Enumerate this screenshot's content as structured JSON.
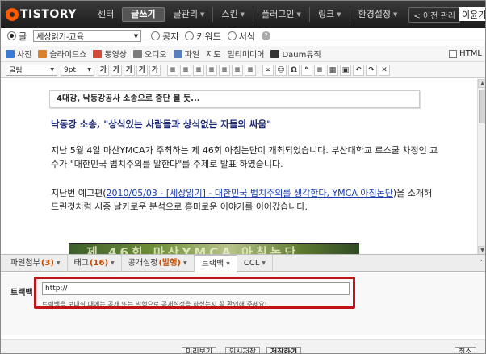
{
  "topbar": {
    "logo": "TISTORY",
    "nav": [
      {
        "label": "센터",
        "active": false,
        "caret": false
      },
      {
        "label": "글쓰기",
        "active": true,
        "caret": false
      },
      {
        "label": "글관리",
        "active": false,
        "caret": true
      },
      {
        "label": "스킨",
        "active": false,
        "caret": true
      },
      {
        "label": "플러그인",
        "active": false,
        "caret": true
      },
      {
        "label": "링크",
        "active": false,
        "caret": true
      },
      {
        "label": "환경설정",
        "active": false,
        "caret": true
      }
    ],
    "old_admin": "< 이전 관리",
    "user": "이윤기"
  },
  "category_row": {
    "type_label": "글",
    "category_value": "세상읽기-교육",
    "options": [
      "공지",
      "키워드",
      "서식"
    ]
  },
  "toolbar1": {
    "items": [
      {
        "label": "사진",
        "icon": "photo-icon",
        "color": "#3a7bd5"
      },
      {
        "label": "슬라이드쇼",
        "icon": "slideshow-icon",
        "color": "#d9822b"
      },
      {
        "label": "동영상",
        "icon": "video-icon",
        "color": "#d24a3c"
      },
      {
        "label": "오디오",
        "icon": "audio-icon",
        "color": "#7b7b7b"
      },
      {
        "label": "파일",
        "icon": "file-icon",
        "color": "#5a7fbf"
      },
      {
        "label": "지도",
        "icon": "",
        "color": ""
      },
      {
        "label": "멀티미디어",
        "icon": "",
        "color": ""
      },
      {
        "label": "Daum뮤직",
        "icon": "music-icon",
        "color": "#333333"
      }
    ],
    "html_label": "HTML"
  },
  "toolbar2": {
    "font": "굴림",
    "size": "9pt",
    "buttons": [
      "가",
      "가",
      "가",
      "가",
      "가",
      "≡",
      "≡",
      "≡",
      "≡",
      "≡",
      "≡",
      "≡",
      "∞",
      "☺",
      "Ω",
      "“",
      "≡",
      "▦",
      "▣",
      "↶",
      "↷",
      "✕"
    ]
  },
  "editor": {
    "box_title": "4대강, 낙동강공사 소송으로 중단 될 듯...",
    "heading": "낙동강 소송, \"상식있는 사람들과 상식없는 자들의 싸움\"",
    "paragraph1": "지난 5월 4일 마산YMCA가 주최하는 제 46회 아침논단이 개최되었습니다. 부산대학교 로스쿨 차정인 교수가 \"대한민국 법치주의를 말한다\"를 주제로 발표 하였습니다.",
    "paragraph2_prefix": "지난번 예고편(",
    "paragraph2_link": "2010/05/03 - [세상읽기] - 대한민국 법치주의를 생각한다, YMCA 아침논단",
    "paragraph2_suffix": ")을 소개해드린것처럼 시종 날카로운 분석으로 흥미로운 이야기를 이어갔습니다.",
    "photo_text": "제 46회 마산YMCA 아침논단"
  },
  "tabs": [
    {
      "label": "파일첨부",
      "num": "(3)",
      "active": false
    },
    {
      "label": "태그",
      "num": "(16)",
      "active": false
    },
    {
      "label": "공개설정",
      "num": "(발행)",
      "active": false
    },
    {
      "label": "트랙백",
      "num": "",
      "active": true
    },
    {
      "label": "CCL",
      "num": "",
      "active": false
    }
  ],
  "trackback": {
    "label": "트랙백",
    "value": "http://",
    "note": "트랙백을 보내실 때에는 공개 또는 발행으로 공개설정을 하셨는지 꼭 확인해 주세요!"
  },
  "bottom": {
    "preview": "미리보기",
    "draft": "임시저장",
    "save": "저장하기",
    "cancel": "취소"
  },
  "colors": {
    "highlight_box": "#c0141a",
    "heading": "#1e2a78",
    "tab_count": "#c84b00"
  }
}
